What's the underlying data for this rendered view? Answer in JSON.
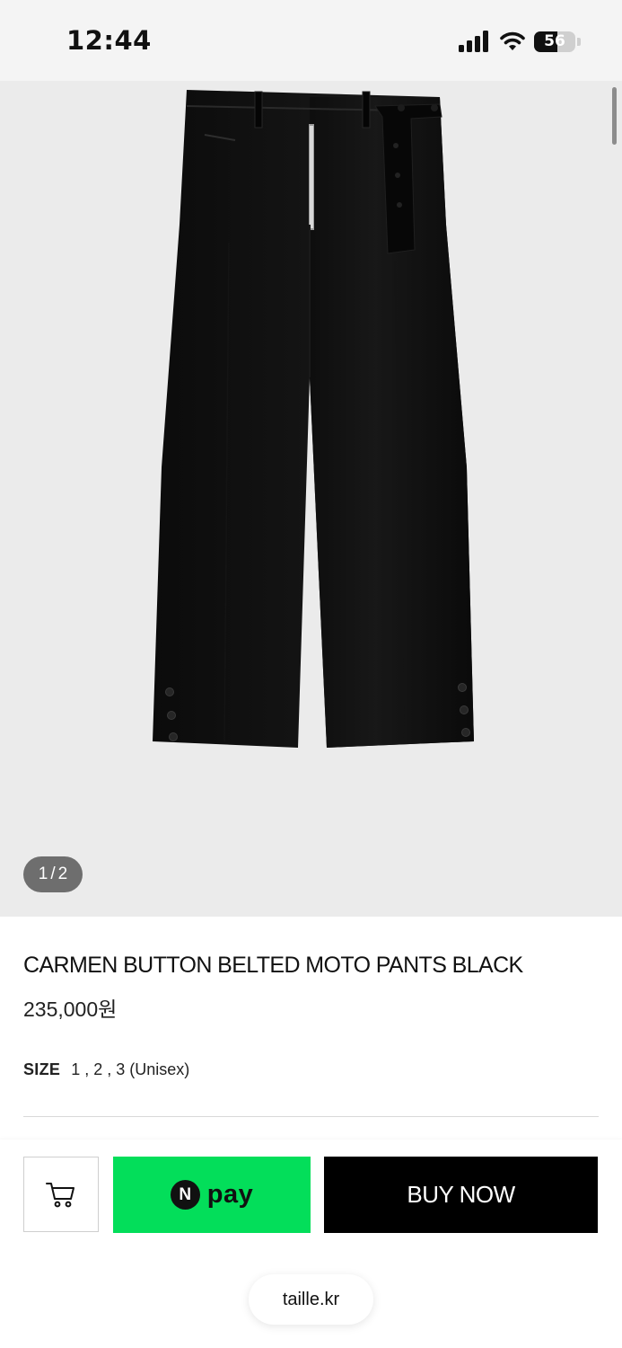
{
  "status_bar": {
    "time": "12:44",
    "battery": "56",
    "battery_level": 0.56,
    "icons": [
      "signal-icon",
      "wifi-icon",
      "battery-icon"
    ]
  },
  "gallery": {
    "current_page": "1",
    "separator": "/",
    "total_pages": "2",
    "image_subject": "black-wide-leg-pants-product-photo"
  },
  "product": {
    "title": "CARMEN BUTTON BELTED MOTO PANTS BLACK",
    "price": "235,000원",
    "size_label": "SIZE",
    "size_values": "1 , 2 , 3 (Unisex)"
  },
  "actions": {
    "cart_icon": "cart-icon",
    "npay_badge": "N",
    "npay_text": "pay",
    "npay_color": "#03de5a",
    "buy_now": "BUY NOW"
  },
  "browser": {
    "url": "taille.kr"
  }
}
